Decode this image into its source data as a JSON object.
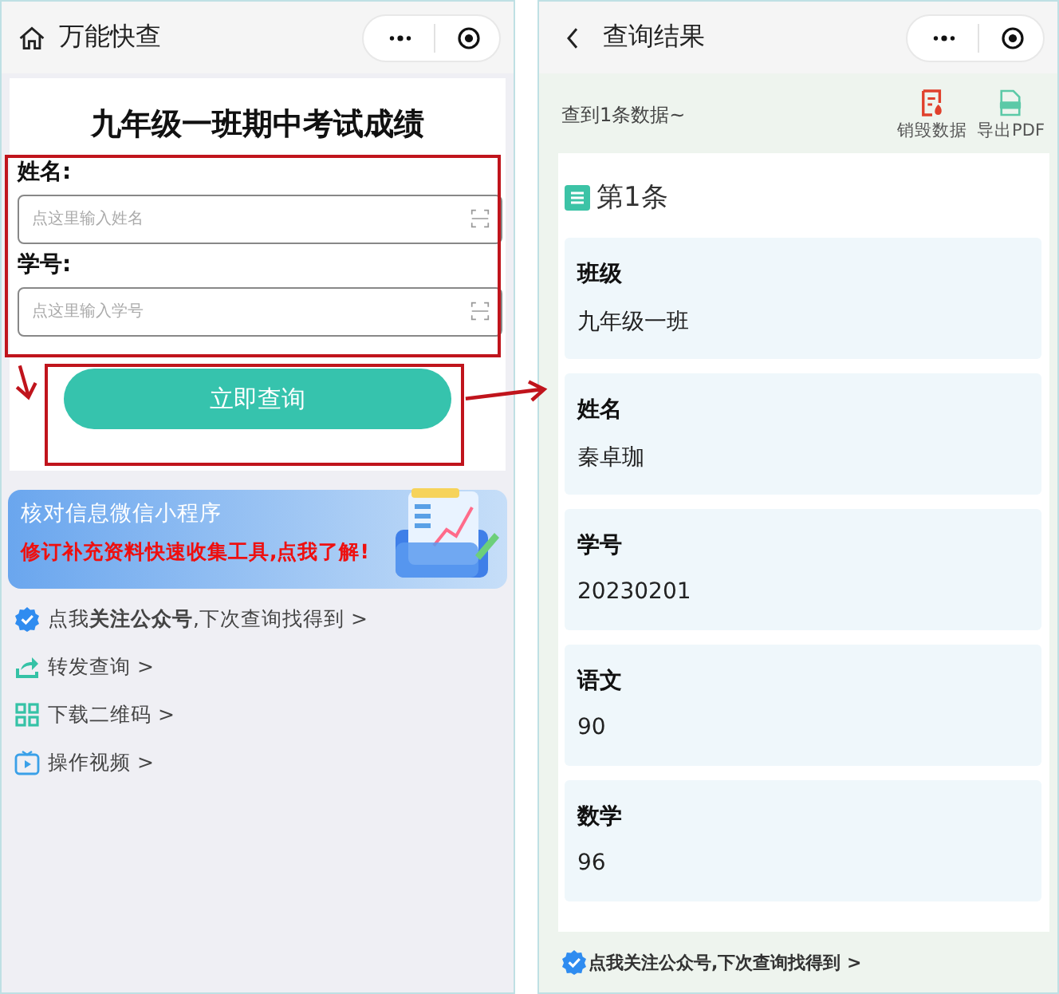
{
  "left": {
    "title": "万能快查",
    "form_title": "九年级一班期中考试成绩",
    "fields": [
      {
        "label": "姓名:",
        "placeholder": "点这里输入姓名"
      },
      {
        "label": "学号:",
        "placeholder": "点这里输入学号"
      }
    ],
    "submit": "立即查询",
    "banner": {
      "title": "核对信息微信小程序",
      "subtitle": "修订补充资料快速收集工具,点我了解!"
    },
    "links": [
      {
        "kind": "follow",
        "text": "点我**关注公众号**,下次查询找得到 >"
      },
      {
        "kind": "share",
        "text": "转发查询 >"
      },
      {
        "kind": "qrcode",
        "text": "下载二维码 >"
      },
      {
        "kind": "video",
        "text": "操作视频 >"
      }
    ]
  },
  "right": {
    "title": "查询结果",
    "summary": "查到1条数据~",
    "actions": [
      {
        "kind": "destroy",
        "label": "销毁数据"
      },
      {
        "kind": "pdf",
        "label": "导出PDF"
      }
    ],
    "record_title": "第1条",
    "fields": [
      {
        "label": "班级",
        "value": "九年级一班"
      },
      {
        "label": "姓名",
        "value": "秦卓珈"
      },
      {
        "label": "学号",
        "value": "20230201"
      },
      {
        "label": "语文",
        "value": "90"
      },
      {
        "label": "数学",
        "value": "96"
      }
    ],
    "footer": "点我关注公众号,下次查询找得到 >"
  }
}
